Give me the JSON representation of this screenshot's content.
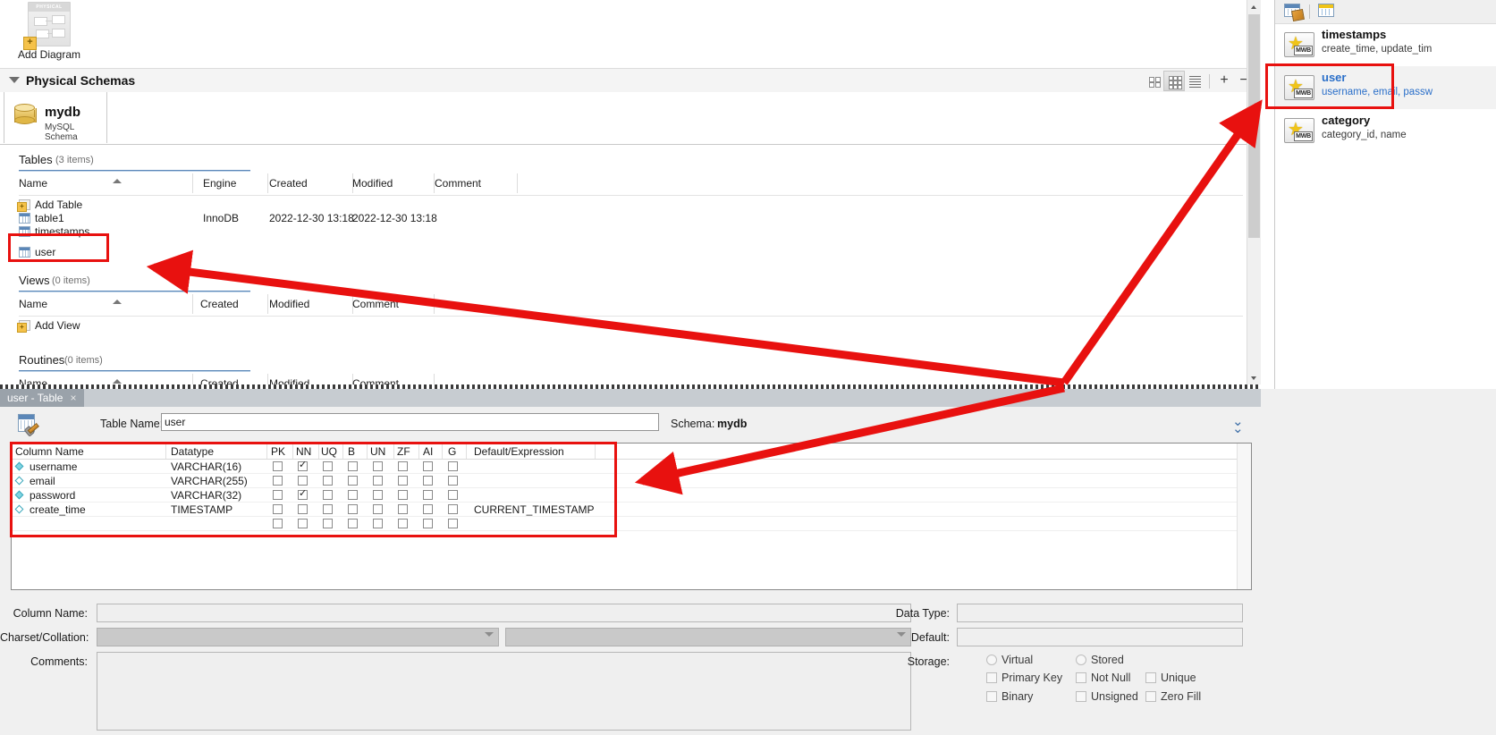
{
  "toolbar": {
    "add_diagram_label": "Add Diagram",
    "physical_schemas_title": "Physical Schemas",
    "plus_label": "+",
    "minus_label": "−"
  },
  "schema_tab": {
    "name": "mydb",
    "subtitle": "MySQL Schema"
  },
  "sections": [
    {
      "id": "tables",
      "title": "Tables",
      "count": "(3 items)",
      "columns": [
        "Name",
        "Engine",
        "Created",
        "Modified",
        "Comment"
      ],
      "rows": [
        {
          "name": "Add Table",
          "engine": "",
          "created": "",
          "modified": "",
          "comment": "",
          "icon": "add-table-icon"
        },
        {
          "name": "table1",
          "engine": "InnoDB",
          "created": "2022-12-30 13:18",
          "modified": "2022-12-30 13:18",
          "comment": "",
          "icon": "table-icon"
        },
        {
          "name": "timestamps",
          "engine": "",
          "created": "",
          "modified": "",
          "comment": "",
          "icon": "table-icon"
        },
        {
          "name": "user",
          "engine": "",
          "created": "",
          "modified": "",
          "comment": "",
          "icon": "table-icon"
        }
      ]
    },
    {
      "id": "views",
      "title": "Views",
      "count": "(0 items)",
      "columns": [
        "Name",
        "Created",
        "Modified",
        "Comment"
      ],
      "rows": [
        {
          "name": "Add View",
          "icon": "add-view-icon"
        }
      ]
    },
    {
      "id": "routines",
      "title": "Routines",
      "count": "(0 items)",
      "columns": [
        "Name",
        "Created",
        "Modified",
        "Comment"
      ],
      "rows": []
    }
  ],
  "editor": {
    "tab_label": "user - Table",
    "tab_close": "×",
    "table_name_label": "Table Name:",
    "table_name_value": "user",
    "schema_label": "Schema:",
    "schema_value": "mydb",
    "grid_columns": [
      "Column Name",
      "Datatype",
      "PK",
      "NN",
      "UQ",
      "B",
      "UN",
      "ZF",
      "AI",
      "G",
      "Default/Expression"
    ],
    "rows": [
      {
        "name": "username",
        "datatype": "VARCHAR(16)",
        "pk": false,
        "nn": true,
        "uq": false,
        "b": false,
        "un": false,
        "zf": false,
        "ai": false,
        "g": false,
        "default": "",
        "key_filled": true
      },
      {
        "name": "email",
        "datatype": "VARCHAR(255)",
        "pk": false,
        "nn": false,
        "uq": false,
        "b": false,
        "un": false,
        "zf": false,
        "ai": false,
        "g": false,
        "default": "",
        "key_filled": false
      },
      {
        "name": "password",
        "datatype": "VARCHAR(32)",
        "pk": false,
        "nn": true,
        "uq": false,
        "b": false,
        "un": false,
        "zf": false,
        "ai": false,
        "g": false,
        "default": "",
        "key_filled": true
      },
      {
        "name": "create_time",
        "datatype": "TIMESTAMP",
        "pk": false,
        "nn": false,
        "uq": false,
        "b": false,
        "un": false,
        "zf": false,
        "ai": false,
        "g": false,
        "default": "CURRENT_TIMESTAMP",
        "key_filled": false
      },
      {
        "name": "",
        "datatype": "",
        "pk": false,
        "nn": false,
        "uq": false,
        "b": false,
        "un": false,
        "zf": false,
        "ai": false,
        "g": false,
        "default": "",
        "key_filled": null
      }
    ]
  },
  "properties": {
    "column_name_label": "Column Name:",
    "column_name_value": "",
    "charset_label": "Charset/Collation:",
    "charset_value": "",
    "collation_value": "",
    "comments_label": "Comments:",
    "comments_value": "",
    "data_type_label": "Data Type:",
    "data_type_value": "",
    "default_label": "Default:",
    "default_value": "",
    "storage_label": "Storage:",
    "storage_options": [
      "Virtual",
      "Stored"
    ],
    "flags": [
      [
        "Primary Key",
        "Not Null",
        "Unique"
      ],
      [
        "Binary",
        "Unsigned",
        "Zero Fill"
      ]
    ]
  },
  "right_panel": {
    "objects": [
      {
        "title": "timestamps",
        "sub": "create_time, update_tim",
        "selected": false
      },
      {
        "title": "user",
        "sub": "username, email, passw",
        "selected": true
      },
      {
        "title": "category",
        "sub": "category_id, name",
        "selected": false
      }
    ]
  },
  "colors": {
    "annotation_red": "#e8110f",
    "selection_blue": "#2a6fc9",
    "tab_active": "#9aa2aa"
  }
}
